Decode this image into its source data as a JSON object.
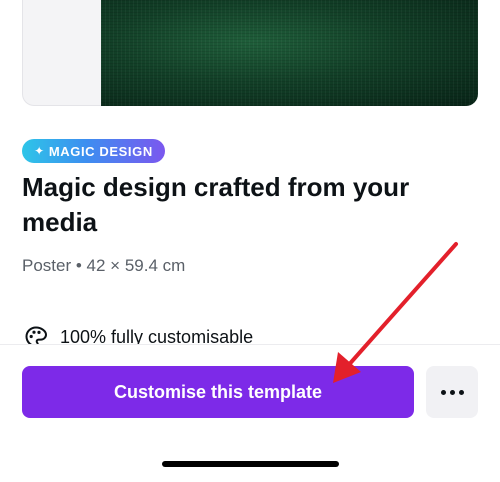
{
  "template": {
    "badge_label": "MAGIC DESIGN",
    "title": "Magic design crafted from your media",
    "meta": "Poster • 42 × 59.4 cm",
    "feature_text": "100% fully customisable"
  },
  "actions": {
    "primary_label": "Customise this template"
  },
  "icons": {
    "badge": "sparkle-icon",
    "feature": "palette-icon",
    "more": "more-horizontal-icon"
  },
  "colors": {
    "primary": "#7d2ae8",
    "annotation_arrow": "#e3202b",
    "badge_gradient": [
      "#2ec5e8",
      "#7b57ef"
    ]
  }
}
